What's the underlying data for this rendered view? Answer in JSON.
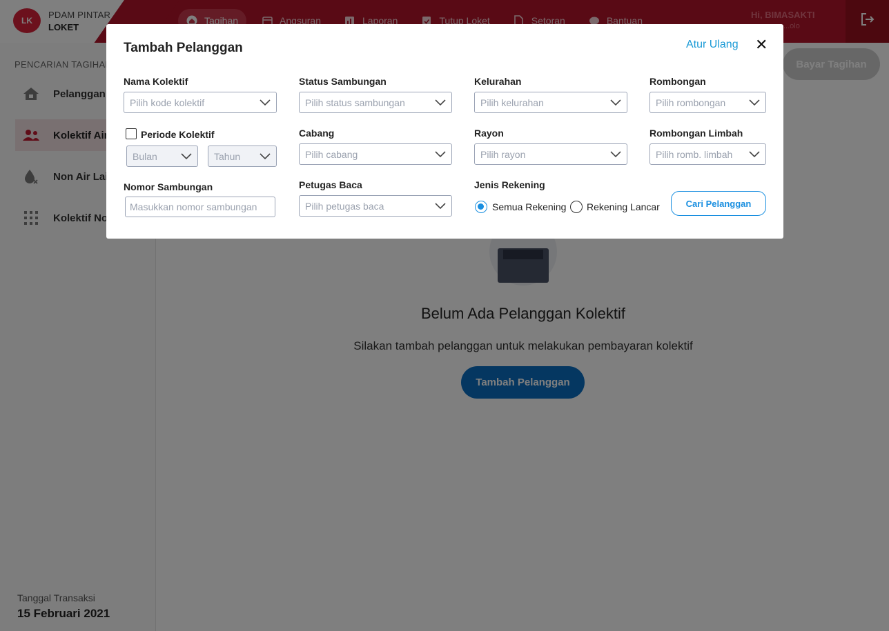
{
  "brand": {
    "logo_text": "LK",
    "line1": "PDAM PINTAR",
    "line2": "LOKET"
  },
  "nav": [
    {
      "label": "Tagihan",
      "icon": "home-icon"
    },
    {
      "label": "Angsuran",
      "icon": "calendar-icon"
    },
    {
      "label": "Laporan",
      "icon": "chart-icon"
    },
    {
      "label": "Tutup Loket",
      "icon": "clipboard-check-icon"
    },
    {
      "label": "Setoran",
      "icon": "document-icon"
    },
    {
      "label": "Bantuan",
      "icon": "chat-icon"
    }
  ],
  "user": {
    "greeting": "Hi, BIMASAKTI",
    "sub": "...olo"
  },
  "sidebar": {
    "title": "PENCARIAN TAGIHAN",
    "items": [
      {
        "label": "Pelanggan",
        "icon": "house-icon"
      },
      {
        "label": "Kolektif Air",
        "icon": "users-icon"
      },
      {
        "label": "Non Air Lain",
        "icon": "drop-icon"
      },
      {
        "label": "Kolektif Non Air",
        "icon": "grid-icon"
      }
    ],
    "trx_label": "Tanggal Transaksi",
    "trx_date": "15 Februari 2021"
  },
  "main": {
    "bayar_label": "Bayar Tagihan",
    "empty_title": "Belum Ada Pelanggan Kolektif",
    "empty_sub": "Silakan tambah pelanggan untuk melakukan pembayaran kolektif",
    "empty_button": "Tambah Pelanggan"
  },
  "modal": {
    "title": "Tambah Pelanggan",
    "reset_label": "Atur Ulang",
    "close_glyph": "✕",
    "nama_kolektif": {
      "label": "Nama Kolektif",
      "placeholder": "Pilih kode kolektif"
    },
    "periode": {
      "label": "Periode Kolektif",
      "bulan": "Bulan",
      "tahun": "Tahun"
    },
    "nomor": {
      "label": "Nomor Sambungan",
      "placeholder": "Masukkan nomor sambungan"
    },
    "status": {
      "label": "Status Sambungan",
      "placeholder": "Pilih status sambungan"
    },
    "cabang": {
      "label": "Cabang",
      "placeholder": "Pilih cabang"
    },
    "petugas": {
      "label": "Petugas Baca",
      "placeholder": "Pilih petugas baca"
    },
    "kelurahan": {
      "label": "Kelurahan",
      "placeholder": "Pilih kelurahan"
    },
    "rayon": {
      "label": "Rayon",
      "placeholder": "Pilih rayon"
    },
    "jenis": {
      "label": "Jenis Rekening",
      "opt1": "Semua Rekening",
      "opt2": "Rekening Lancar"
    },
    "rombongan": {
      "label": "Rombongan",
      "placeholder": "Pilih rombongan"
    },
    "limbah": {
      "label": "Rombongan Limbah",
      "placeholder": "Pilih romb. limbah"
    },
    "search_button": "Cari Pelanggan"
  }
}
